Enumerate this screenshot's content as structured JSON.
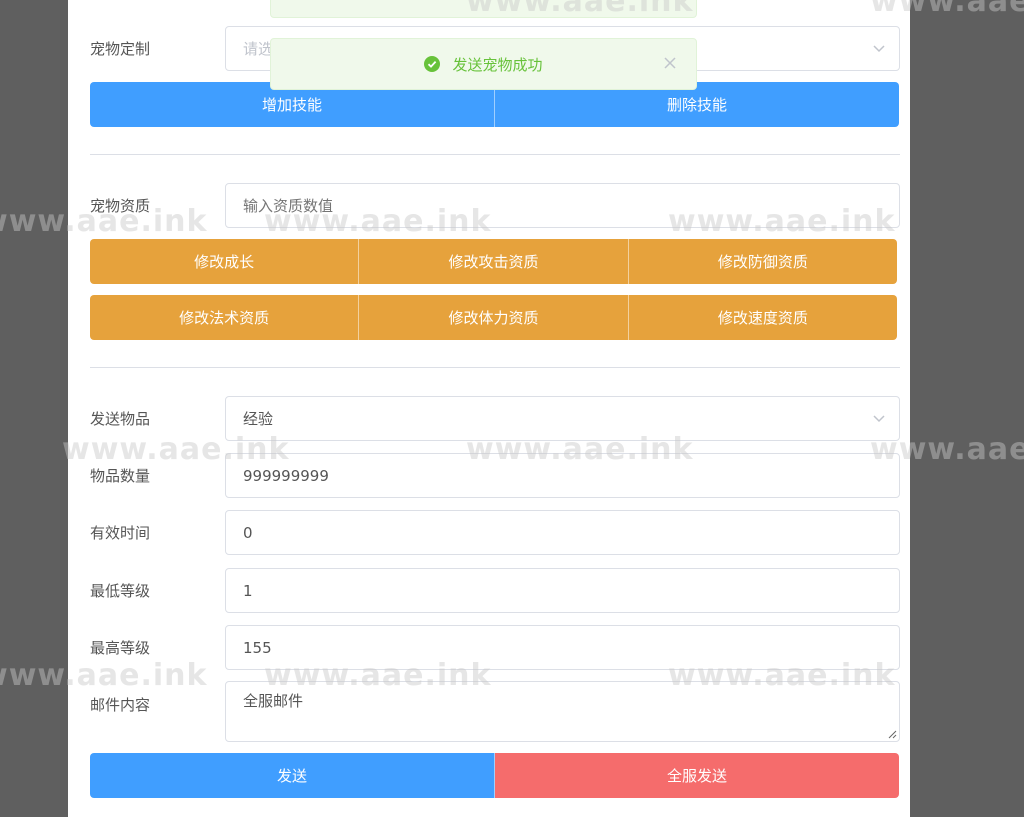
{
  "pet_custom": {
    "label": "宠物定制",
    "placeholder": "请选",
    "add_skill": "增加技能",
    "delete_skill": "删除技能"
  },
  "toast": {
    "message": "发送宠物成功"
  },
  "pet_aptitude": {
    "label": "宠物资质",
    "placeholder": "输入资质数值",
    "buttons_row1": [
      "修改成长",
      "修改攻击资质",
      "修改防御资质"
    ],
    "buttons_row2": [
      "修改法术资质",
      "修改体力资质",
      "修改速度资质"
    ]
  },
  "send_item": {
    "item_label": "发送物品",
    "item_value": "经验",
    "qty_label": "物品数量",
    "qty_value": "999999999",
    "time_label": "有效时间",
    "time_value": "0",
    "min_label": "最低等级",
    "min_value": "1",
    "max_label": "最高等级",
    "max_value": "155",
    "mail_label": "邮件内容",
    "mail_value": "全服邮件",
    "send": "发送",
    "send_all": "全服发送"
  },
  "watermark": "www.aae.ink",
  "colors": {
    "primary": "#409eff",
    "warning": "#e6a23c",
    "danger": "#f56c6c",
    "success": "#67c23a"
  }
}
